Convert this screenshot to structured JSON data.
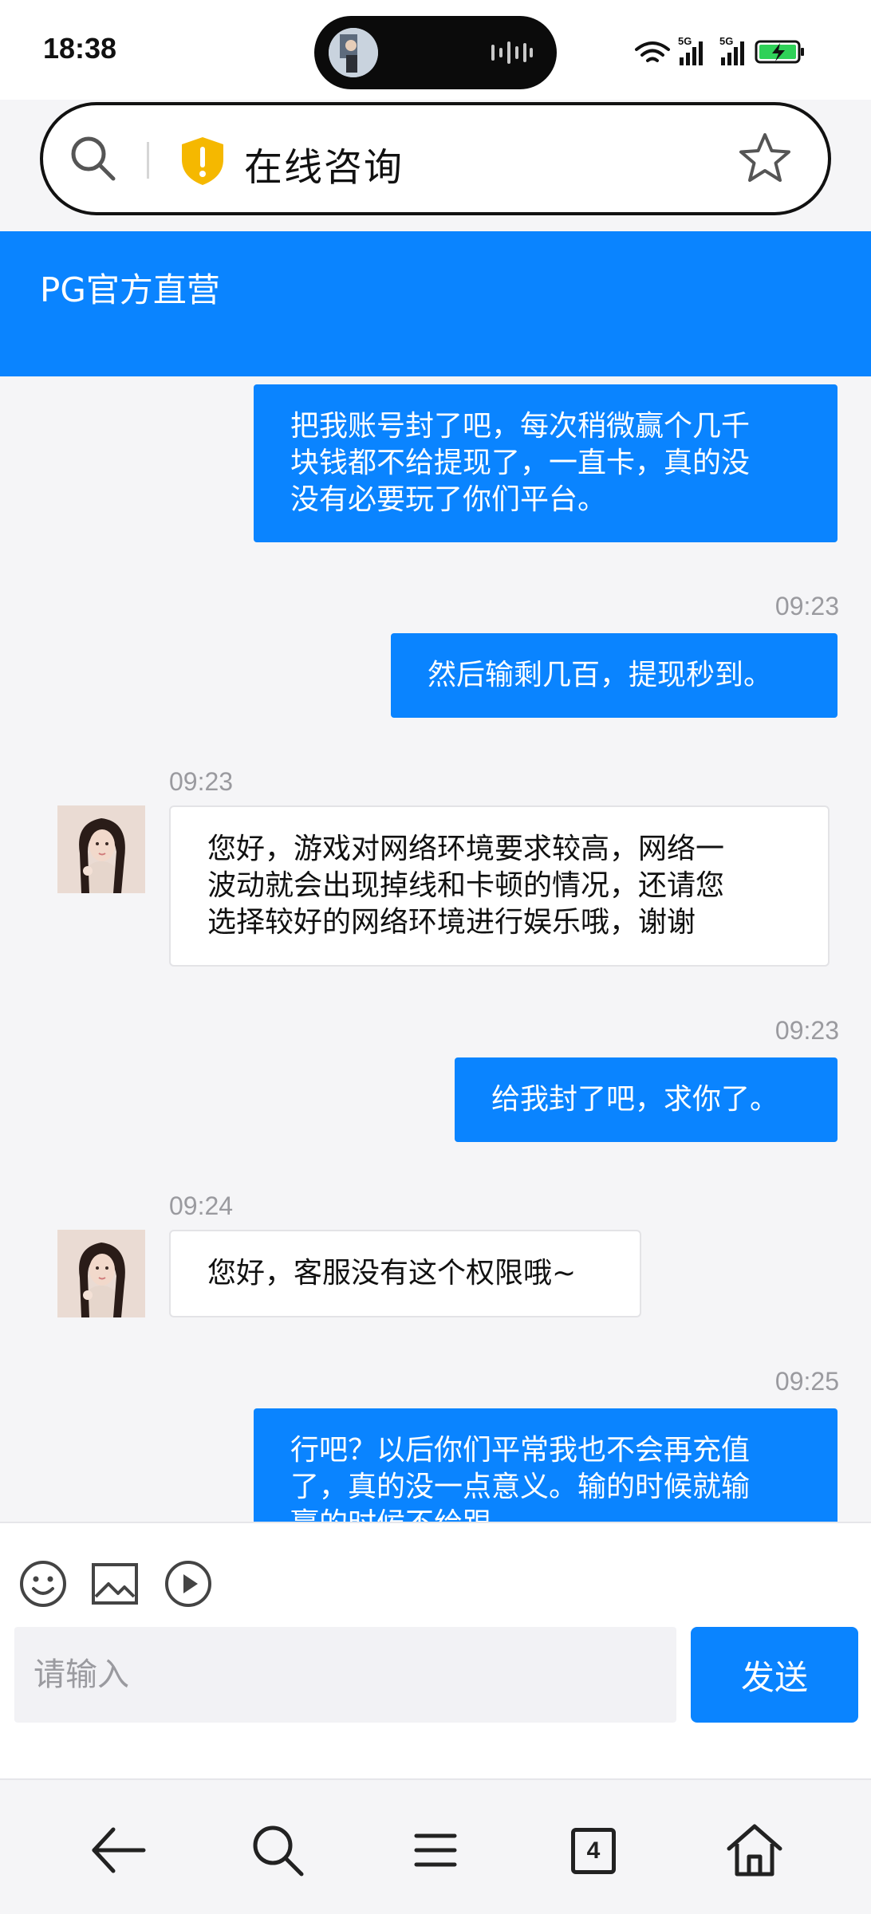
{
  "status_bar": {
    "time": "18:38",
    "network_labels": [
      "5G",
      "5G"
    ]
  },
  "browser": {
    "page_title": "在线咨询",
    "tab_count": "4"
  },
  "chat": {
    "header_title": "PG官方直营",
    "messages": [
      {
        "side": "out",
        "time": "",
        "lines": [
          "把我账号封了吧，每次稍微赢个几千",
          "块钱都不给提现了，一直卡，真的没",
          "没有必要玩了你们平台。"
        ]
      },
      {
        "side": "out",
        "time": "09:23",
        "lines": [
          "然后输剩几百，提现秒到。"
        ]
      },
      {
        "side": "in",
        "time": "09:23",
        "lines": [
          "您好，游戏对网络环境要求较高，网络一",
          "波动就会出现掉线和卡顿的情况，还请您",
          "选择较好的网络环境进行娱乐哦，谢谢"
        ]
      },
      {
        "side": "out",
        "time": "09:23",
        "lines": [
          "给我封了吧，求你了。"
        ]
      },
      {
        "side": "in",
        "time": "09:24",
        "lines": [
          "您好，客服没有这个权限哦~"
        ]
      },
      {
        "side": "out",
        "time": "09:25",
        "lines": [
          "行吧？以后你们平常我也不会再充值",
          "了，真的没一点意义。输的时候就输",
          "赢的时候不给跟"
        ]
      }
    ]
  },
  "composer": {
    "placeholder": "请输入",
    "send_label": "发送"
  },
  "colors": {
    "accent": "#0a84ff",
    "incoming_bg": "#ffffff",
    "page_bg": "#f5f5f7"
  }
}
